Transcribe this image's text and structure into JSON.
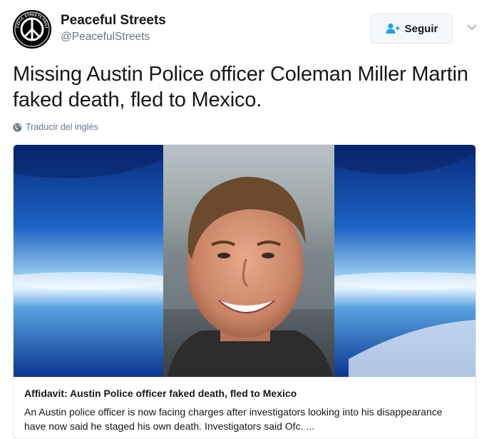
{
  "user": {
    "display_name": "Peaceful Streets",
    "handle": "@PeacefulStreets",
    "avatar_text": "PEACEFUL STREETS PROJECT"
  },
  "follow_button": {
    "label": "Seguir"
  },
  "tweet": {
    "text": "Missing Austin Police officer Coleman Miller Martin faked death, fled to Mexico.",
    "translate_label": "Traducir del inglés"
  },
  "card": {
    "title": "Affidavit: Austin Police officer faked death, fled to Mexico",
    "description": "An Austin police officer is now facing charges after investigators looking into his disappearance have now said he staged his own death. Investigators said Ofc. ..."
  },
  "colors": {
    "text": "#14171a",
    "secondary": "#657786",
    "accent": "#1da1f2",
    "border": "#e1e8ed"
  },
  "icons": {
    "follow": "person-add-icon",
    "caret": "chevron-down-icon",
    "translate": "globe-icon"
  }
}
